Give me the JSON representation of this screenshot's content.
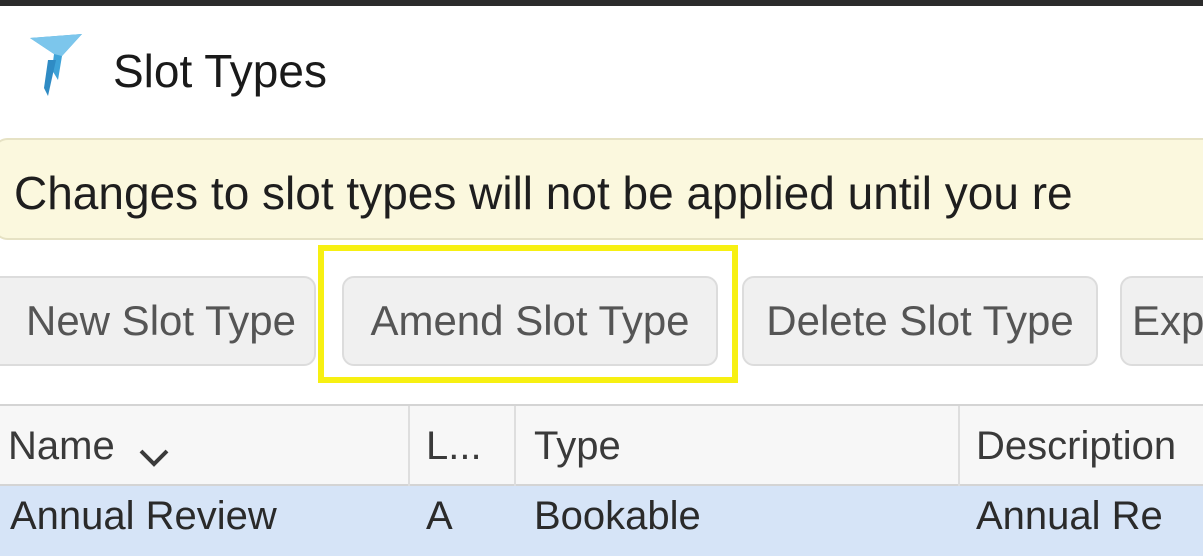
{
  "window": {
    "title": "Slot Types",
    "app_icon": "funnel-icon"
  },
  "notice": {
    "text": "Changes to slot types will not be applied until you re"
  },
  "toolbar": {
    "new_label": "New Slot Type",
    "amend_label": "Amend Slot Type",
    "delete_label": "Delete Slot Type",
    "export_label": "Exp"
  },
  "colors": {
    "highlight": "#f7f012",
    "notice_bg": "#fbf8de",
    "selected_row": "#d6e4f7"
  },
  "grid": {
    "columns": [
      "Name",
      "L...",
      "Type",
      "Description"
    ],
    "sort_icon": "chevron-down-icon",
    "rows": [
      {
        "name": "Annual Review",
        "short": "A",
        "type": "Bookable",
        "description": "Annual Re"
      }
    ]
  }
}
